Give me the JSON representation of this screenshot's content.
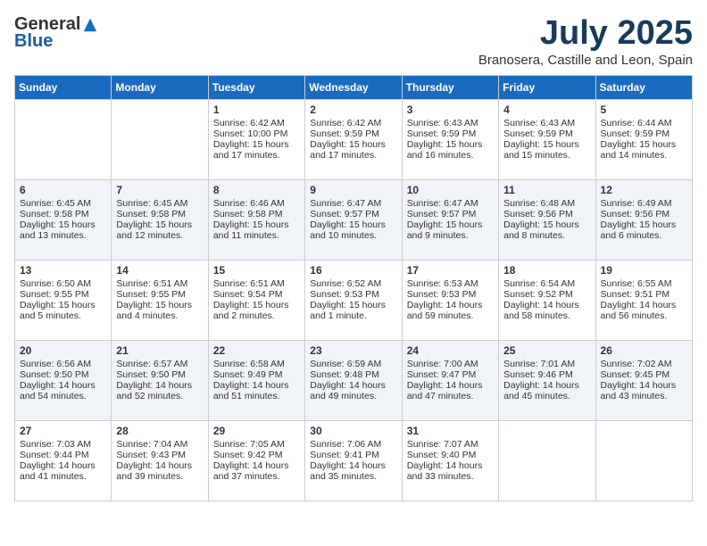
{
  "header": {
    "logo_general": "General",
    "logo_blue": "Blue",
    "month_title": "July 2025",
    "location": "Branosera, Castille and Leon, Spain"
  },
  "calendar": {
    "weekdays": [
      "Sunday",
      "Monday",
      "Tuesday",
      "Wednesday",
      "Thursday",
      "Friday",
      "Saturday"
    ],
    "weeks": [
      [
        {
          "day": "",
          "sunrise": "",
          "sunset": "",
          "daylight": ""
        },
        {
          "day": "",
          "sunrise": "",
          "sunset": "",
          "daylight": ""
        },
        {
          "day": "1",
          "sunrise": "Sunrise: 6:42 AM",
          "sunset": "Sunset: 10:00 PM",
          "daylight": "Daylight: 15 hours and 17 minutes."
        },
        {
          "day": "2",
          "sunrise": "Sunrise: 6:42 AM",
          "sunset": "Sunset: 9:59 PM",
          "daylight": "Daylight: 15 hours and 17 minutes."
        },
        {
          "day": "3",
          "sunrise": "Sunrise: 6:43 AM",
          "sunset": "Sunset: 9:59 PM",
          "daylight": "Daylight: 15 hours and 16 minutes."
        },
        {
          "day": "4",
          "sunrise": "Sunrise: 6:43 AM",
          "sunset": "Sunset: 9:59 PM",
          "daylight": "Daylight: 15 hours and 15 minutes."
        },
        {
          "day": "5",
          "sunrise": "Sunrise: 6:44 AM",
          "sunset": "Sunset: 9:59 PM",
          "daylight": "Daylight: 15 hours and 14 minutes."
        }
      ],
      [
        {
          "day": "6",
          "sunrise": "Sunrise: 6:45 AM",
          "sunset": "Sunset: 9:58 PM",
          "daylight": "Daylight: 15 hours and 13 minutes."
        },
        {
          "day": "7",
          "sunrise": "Sunrise: 6:45 AM",
          "sunset": "Sunset: 9:58 PM",
          "daylight": "Daylight: 15 hours and 12 minutes."
        },
        {
          "day": "8",
          "sunrise": "Sunrise: 6:46 AM",
          "sunset": "Sunset: 9:58 PM",
          "daylight": "Daylight: 15 hours and 11 minutes."
        },
        {
          "day": "9",
          "sunrise": "Sunrise: 6:47 AM",
          "sunset": "Sunset: 9:57 PM",
          "daylight": "Daylight: 15 hours and 10 minutes."
        },
        {
          "day": "10",
          "sunrise": "Sunrise: 6:47 AM",
          "sunset": "Sunset: 9:57 PM",
          "daylight": "Daylight: 15 hours and 9 minutes."
        },
        {
          "day": "11",
          "sunrise": "Sunrise: 6:48 AM",
          "sunset": "Sunset: 9:56 PM",
          "daylight": "Daylight: 15 hours and 8 minutes."
        },
        {
          "day": "12",
          "sunrise": "Sunrise: 6:49 AM",
          "sunset": "Sunset: 9:56 PM",
          "daylight": "Daylight: 15 hours and 6 minutes."
        }
      ],
      [
        {
          "day": "13",
          "sunrise": "Sunrise: 6:50 AM",
          "sunset": "Sunset: 9:55 PM",
          "daylight": "Daylight: 15 hours and 5 minutes."
        },
        {
          "day": "14",
          "sunrise": "Sunrise: 6:51 AM",
          "sunset": "Sunset: 9:55 PM",
          "daylight": "Daylight: 15 hours and 4 minutes."
        },
        {
          "day": "15",
          "sunrise": "Sunrise: 6:51 AM",
          "sunset": "Sunset: 9:54 PM",
          "daylight": "Daylight: 15 hours and 2 minutes."
        },
        {
          "day": "16",
          "sunrise": "Sunrise: 6:52 AM",
          "sunset": "Sunset: 9:53 PM",
          "daylight": "Daylight: 15 hours and 1 minute."
        },
        {
          "day": "17",
          "sunrise": "Sunrise: 6:53 AM",
          "sunset": "Sunset: 9:53 PM",
          "daylight": "Daylight: 14 hours and 59 minutes."
        },
        {
          "day": "18",
          "sunrise": "Sunrise: 6:54 AM",
          "sunset": "Sunset: 9:52 PM",
          "daylight": "Daylight: 14 hours and 58 minutes."
        },
        {
          "day": "19",
          "sunrise": "Sunrise: 6:55 AM",
          "sunset": "Sunset: 9:51 PM",
          "daylight": "Daylight: 14 hours and 56 minutes."
        }
      ],
      [
        {
          "day": "20",
          "sunrise": "Sunrise: 6:56 AM",
          "sunset": "Sunset: 9:50 PM",
          "daylight": "Daylight: 14 hours and 54 minutes."
        },
        {
          "day": "21",
          "sunrise": "Sunrise: 6:57 AM",
          "sunset": "Sunset: 9:50 PM",
          "daylight": "Daylight: 14 hours and 52 minutes."
        },
        {
          "day": "22",
          "sunrise": "Sunrise: 6:58 AM",
          "sunset": "Sunset: 9:49 PM",
          "daylight": "Daylight: 14 hours and 51 minutes."
        },
        {
          "day": "23",
          "sunrise": "Sunrise: 6:59 AM",
          "sunset": "Sunset: 9:48 PM",
          "daylight": "Daylight: 14 hours and 49 minutes."
        },
        {
          "day": "24",
          "sunrise": "Sunrise: 7:00 AM",
          "sunset": "Sunset: 9:47 PM",
          "daylight": "Daylight: 14 hours and 47 minutes."
        },
        {
          "day": "25",
          "sunrise": "Sunrise: 7:01 AM",
          "sunset": "Sunset: 9:46 PM",
          "daylight": "Daylight: 14 hours and 45 minutes."
        },
        {
          "day": "26",
          "sunrise": "Sunrise: 7:02 AM",
          "sunset": "Sunset: 9:45 PM",
          "daylight": "Daylight: 14 hours and 43 minutes."
        }
      ],
      [
        {
          "day": "27",
          "sunrise": "Sunrise: 7:03 AM",
          "sunset": "Sunset: 9:44 PM",
          "daylight": "Daylight: 14 hours and 41 minutes."
        },
        {
          "day": "28",
          "sunrise": "Sunrise: 7:04 AM",
          "sunset": "Sunset: 9:43 PM",
          "daylight": "Daylight: 14 hours and 39 minutes."
        },
        {
          "day": "29",
          "sunrise": "Sunrise: 7:05 AM",
          "sunset": "Sunset: 9:42 PM",
          "daylight": "Daylight: 14 hours and 37 minutes."
        },
        {
          "day": "30",
          "sunrise": "Sunrise: 7:06 AM",
          "sunset": "Sunset: 9:41 PM",
          "daylight": "Daylight: 14 hours and 35 minutes."
        },
        {
          "day": "31",
          "sunrise": "Sunrise: 7:07 AM",
          "sunset": "Sunset: 9:40 PM",
          "daylight": "Daylight: 14 hours and 33 minutes."
        },
        {
          "day": "",
          "sunrise": "",
          "sunset": "",
          "daylight": ""
        },
        {
          "day": "",
          "sunrise": "",
          "sunset": "",
          "daylight": ""
        }
      ]
    ]
  }
}
